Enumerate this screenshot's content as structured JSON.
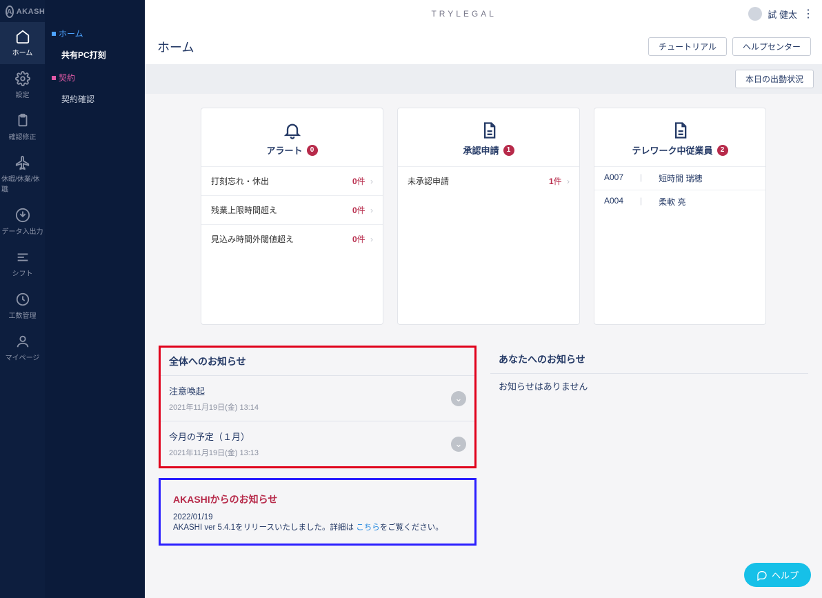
{
  "brand": "AKASHI",
  "header": {
    "org": "TRYLEGAL",
    "user": "試 健太"
  },
  "sidebar_primary": [
    {
      "label": "ホーム"
    },
    {
      "label": "設定"
    },
    {
      "label": "確認修正"
    },
    {
      "label": "休暇/休業/休職"
    },
    {
      "label": "データ入出力"
    },
    {
      "label": "シフト"
    },
    {
      "label": "工数管理"
    },
    {
      "label": "マイページ"
    }
  ],
  "sidebar_secondary": {
    "group1_title": "ホーム",
    "group1_link": "共有PC打刻",
    "group2_title": "契約",
    "group2_link": "契約確認"
  },
  "page": {
    "title": "ホーム",
    "btn_tutorial": "チュートリアル",
    "btn_help": "ヘルプセンター",
    "btn_attendance": "本日の出勤状況"
  },
  "cards": {
    "alert": {
      "title": "アラート",
      "badge": "0",
      "rows": [
        {
          "label": "打刻忘れ・休出",
          "count": "0",
          "unit": "件"
        },
        {
          "label": "残業上限時間超え",
          "count": "0",
          "unit": "件"
        },
        {
          "label": "見込み時間外閾値超え",
          "count": "0",
          "unit": "件"
        }
      ]
    },
    "approval": {
      "title": "承認申請",
      "badge": "1",
      "rows": [
        {
          "label": "未承認申請",
          "count": "1",
          "unit": "件"
        }
      ]
    },
    "telework": {
      "title": "テレワーク中従業員",
      "badge": "2",
      "rows": [
        {
          "code": "A007",
          "name": "短時間 瑞穂"
        },
        {
          "code": "A004",
          "name": "柔軟 亮"
        }
      ]
    }
  },
  "notices_all": {
    "title": "全体へのお知らせ",
    "items": [
      {
        "title": "注意喚起",
        "date": "2021年11月19日(金) 13:14"
      },
      {
        "title": "今月の予定（１月）",
        "date": "2021年11月19日(金) 13:13"
      }
    ]
  },
  "notices_you": {
    "title": "あなたへのお知らせ",
    "empty": "お知らせはありません"
  },
  "akashi_news": {
    "title": "AKASHIからのお知らせ",
    "date": "2022/01/19",
    "body_pre": "AKASHI ver 5.4.1をリリースいたしました。詳細は ",
    "link": "こちら",
    "body_post": "をご覧ください。"
  },
  "help_label": "ヘルプ"
}
